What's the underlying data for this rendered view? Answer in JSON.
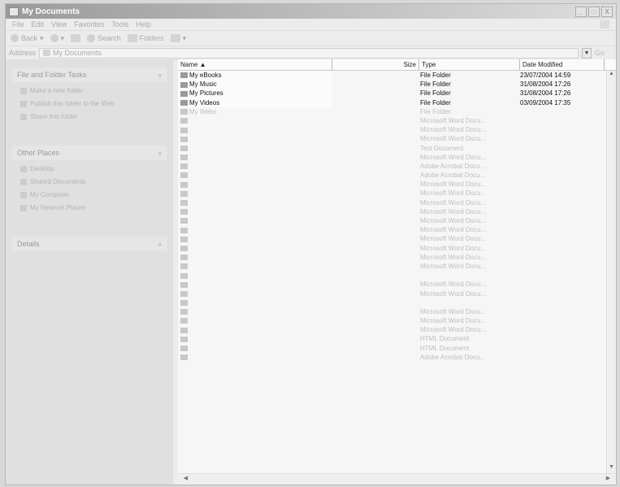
{
  "window": {
    "title": "My Documents"
  },
  "titlebar": {
    "min": "_",
    "max": "□",
    "close": "X"
  },
  "menu": [
    "File",
    "Edit",
    "View",
    "Favorites",
    "Tools",
    "Help"
  ],
  "toolbar": {
    "back": "Back",
    "search": "Search",
    "folders": "Folders"
  },
  "address": {
    "label": "Address",
    "value": "My Documents",
    "go": "Go"
  },
  "taskpane": {
    "file_tasks": {
      "title": "File and Folder Tasks",
      "items": [
        "Make a new folder",
        "Publish this folder to the Web",
        "Share this folder"
      ]
    },
    "other_places": {
      "title": "Other Places",
      "items": [
        "Desktop",
        "Shared Documents",
        "My Computer",
        "My Network Places"
      ]
    },
    "details": {
      "title": "Details"
    }
  },
  "columns": {
    "name": "Name",
    "size": "Size",
    "type": "Type",
    "date": "Date Modified"
  },
  "files": [
    {
      "name": "My eBooks",
      "size": "",
      "type": "File Folder",
      "date": "23/07/2004 14:59",
      "style": "dark"
    },
    {
      "name": "My Music",
      "size": "",
      "type": "File Folder",
      "date": "31/08/2004 17:26",
      "style": "dark"
    },
    {
      "name": "My Pictures",
      "size": "",
      "type": "File Folder",
      "date": "31/08/2004 17:26",
      "style": "dark"
    },
    {
      "name": "My Videos",
      "size": "",
      "type": "File Folder",
      "date": "03/09/2004 17:35",
      "style": "dark"
    },
    {
      "name": "My Webs",
      "size": "",
      "type": "File Folder",
      "date": "",
      "style": "faint"
    },
    {
      "name": "",
      "size": "",
      "type": "Microsoft Word Docu...",
      "date": "",
      "style": "faint"
    },
    {
      "name": "",
      "size": "",
      "type": "Microsoft Word Docu...",
      "date": "",
      "style": "faint"
    },
    {
      "name": "",
      "size": "",
      "type": "Microsoft Word Docu...",
      "date": "",
      "style": "faint"
    },
    {
      "name": "",
      "size": "",
      "type": "Text Document",
      "date": "",
      "style": "faint"
    },
    {
      "name": "",
      "size": "",
      "type": "Microsoft Word Docu...",
      "date": "",
      "style": "faint"
    },
    {
      "name": "",
      "size": "",
      "type": "Adobe Acrobat Docu...",
      "date": "",
      "style": "faint"
    },
    {
      "name": "",
      "size": "",
      "type": "Adobe Acrobat Docu...",
      "date": "",
      "style": "faint"
    },
    {
      "name": "",
      "size": "",
      "type": "Microsoft Word Docu...",
      "date": "",
      "style": "faint"
    },
    {
      "name": "",
      "size": "",
      "type": "Microsoft Word Docu...",
      "date": "",
      "style": "faint"
    },
    {
      "name": "",
      "size": "",
      "type": "Microsoft Word Docu...",
      "date": "",
      "style": "faint"
    },
    {
      "name": "",
      "size": "",
      "type": "Microsoft Word Docu...",
      "date": "",
      "style": "faint"
    },
    {
      "name": "",
      "size": "",
      "type": "Microsoft Word Docu...",
      "date": "",
      "style": "faint"
    },
    {
      "name": "",
      "size": "",
      "type": "Microsoft Word Docu...",
      "date": "",
      "style": "faint"
    },
    {
      "name": "",
      "size": "",
      "type": "Microsoft Word Docu...",
      "date": "",
      "style": "faint"
    },
    {
      "name": "",
      "size": "",
      "type": "Microsoft Word Docu...",
      "date": "",
      "style": "faint"
    },
    {
      "name": "",
      "size": "",
      "type": "Microsoft Word Docu...",
      "date": "",
      "style": "faint"
    },
    {
      "name": "",
      "size": "",
      "type": "Microsoft Word Docu...",
      "date": "",
      "style": "faint"
    },
    {
      "name": "",
      "size": "",
      "type": "",
      "date": "",
      "style": "faint"
    },
    {
      "name": "",
      "size": "",
      "type": "Microsoft Word Docu...",
      "date": "",
      "style": "faint"
    },
    {
      "name": "",
      "size": "",
      "type": "Microsoft Word Docu...",
      "date": "",
      "style": "faint"
    },
    {
      "name": "",
      "size": "",
      "type": "",
      "date": "",
      "style": "faint"
    },
    {
      "name": "",
      "size": "",
      "type": "Microsoft Word Docu...",
      "date": "",
      "style": "faint"
    },
    {
      "name": "",
      "size": "",
      "type": "Microsoft Word Docu...",
      "date": "",
      "style": "faint"
    },
    {
      "name": "",
      "size": "",
      "type": "Microsoft Word Docu...",
      "date": "",
      "style": "faint"
    },
    {
      "name": "",
      "size": "",
      "type": "HTML Document",
      "date": "",
      "style": "faint"
    },
    {
      "name": "",
      "size": "",
      "type": "HTML Document",
      "date": "",
      "style": "faint"
    },
    {
      "name": "",
      "size": "",
      "type": "Adobe Acrobat Docu...",
      "date": "",
      "style": "faint"
    }
  ],
  "sort_indicator": "▲"
}
